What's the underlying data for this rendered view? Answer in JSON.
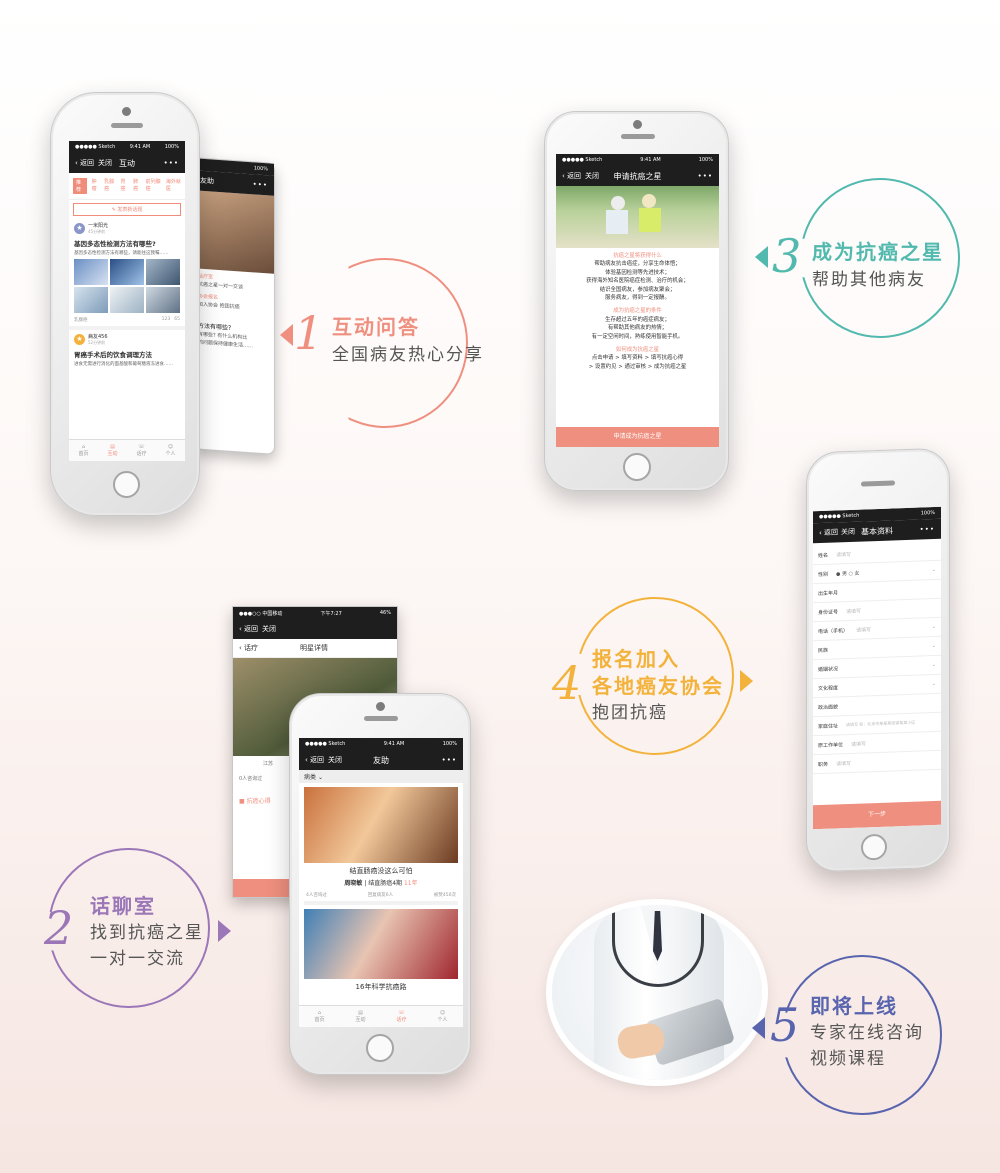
{
  "colors": {
    "coral": "#ef8f7f",
    "teal": "#51b9ad",
    "orange": "#f3b23b",
    "purple": "#9b77b8",
    "blue": "#5864ad"
  },
  "labels": {
    "l1": {
      "num": "1",
      "t1": "互动问答",
      "t2": "全国病友热心分享"
    },
    "l2": {
      "num": "2",
      "t1": "话聊室",
      "t2": "找到抗癌之星",
      "t3": "一对一交流"
    },
    "l3": {
      "num": "3",
      "t1": "成为抗癌之星",
      "t2": "帮助其他病友"
    },
    "l4": {
      "num": "4",
      "t1": "报名加入",
      "t2": "各地癌友协会",
      "t3": "抱团抗癌"
    },
    "l5": {
      "num": "5",
      "t1": "即将上线",
      "t2": "专家在线咨询",
      "t3": "视频课程"
    }
  },
  "p1": {
    "status": {
      "carrier": "●●●●● Sketch",
      "time": "9:41 AM",
      "battery": "100%"
    },
    "nav": {
      "back": "返回",
      "close": "关闭",
      "title": "互动",
      "more": "•••"
    },
    "tabs": [
      "推荐",
      "肿瘤",
      "乳腺癌",
      "胃癌",
      "肺癌",
      "前列腺癌",
      "海外就医"
    ],
    "post_button": "发表新话题",
    "post1": {
      "user": "一米阳光",
      "meta": "45分钟前",
      "title": "基因多态性检测方法有哪些?",
      "body": "基因多态性检测方法有哪些，请能往这我嘱……",
      "tag": "乳腺癌",
      "likes": "123",
      "comments": "65"
    },
    "post2": {
      "user": "病友456",
      "meta": "52分钟前",
      "title": "胃癌手术后的饮食调理方法",
      "body": "进食无需进行消化的面基酸和葡萄糖液冻进食……"
    },
    "tabbar": [
      "首页",
      "互动",
      "话疗",
      "个人"
    ]
  },
  "p1b": {
    "nav": {
      "title": "友助",
      "more": "•••"
    },
    "lines": [
      "话疗室",
      "抗癌之星一对一交谈",
      "协会报名",
      "加入协会 抱团抗癌",
      "方法有哪些?",
      "有哪些? 有什么机构比",
      "的问题保持健康生活……"
    ],
    "likes": "65",
    "comments": "65"
  },
  "p2back": {
    "status": {
      "carrier": "●●●○○ 中国移动",
      "time": "下午7:27",
      "battery": "46%"
    },
    "nav": {
      "back": "返回",
      "close": "关闭"
    },
    "sub": {
      "back": "话疗",
      "title": "明星详情"
    },
    "bits": [
      "江苏",
      "抗",
      "0人咨询过",
      "抗癌心得"
    ]
  },
  "p2": {
    "status": {
      "carrier": "●●●●● Sketch",
      "time": "9:41 AM",
      "battery": "100%"
    },
    "nav": {
      "back": "返回",
      "close": "关闭",
      "title": "友助",
      "more": "•••"
    },
    "filter": "病类",
    "card1": {
      "headline": "结直肠癌没这么可怕",
      "name": "周晓敏",
      "desc": "结直肠癌4期",
      "years": "11年",
      "s1": "4人咨询过",
      "s2": "回复病友6人",
      "s3": "被赞450次"
    },
    "card2": {
      "headline": "16年科学抗癌路",
      "name": "王丽萍"
    },
    "tabbar": [
      "首页",
      "互动",
      "话疗",
      "个人"
    ]
  },
  "p3": {
    "status": {
      "carrier": "●●●●● Sketch",
      "time": "9:41 AM",
      "battery": "100%"
    },
    "nav": {
      "back": "返回",
      "close": "关闭",
      "title": "申请抗癌之星",
      "more": "•••"
    },
    "h1": "抗癌之星将获得什么",
    "s1": [
      "帮助病友抗击癌症，分享生命体悟；",
      "体验基因检测等先进技术；",
      "获得海外知名医院癌症检测、治疗的机会；",
      "结识全国病友，参加病友聚会；",
      "服务病友，得到一定报酬。"
    ],
    "h2": "成为抗癌之星的条件",
    "s2": [
      "生存超过五年的癌症病友；",
      "有帮助其他病友的热情；",
      "有一定空闲时间，熟练使用智能手机。"
    ],
    "h3": "如何成为抗癌之星",
    "s3": [
      "点击申请 > 填写资料 > 填写抗癌心得",
      "> 设置约见 > 通过审核 > 成为抗癌之星"
    ],
    "button": "申请成为抗癌之星"
  },
  "p4": {
    "status": {
      "carrier": "●●●●● Sketch",
      "time": "9:41 AM",
      "battery": "100%"
    },
    "nav": {
      "back": "返回",
      "close": "关闭",
      "title": "基本资料",
      "more": "•••"
    },
    "rows": [
      {
        "k": "姓名",
        "v": "请填写"
      },
      {
        "k": "性别",
        "v": "● 男   ○ 女"
      },
      {
        "k": "出生年月",
        "v": ""
      },
      {
        "k": "身份证号",
        "v": "请填写"
      },
      {
        "k": "电话（手机）",
        "v": "请填写"
      },
      {
        "k": "民族",
        "v": ""
      },
      {
        "k": "婚姻状况",
        "v": ""
      },
      {
        "k": "文化程度",
        "v": ""
      },
      {
        "k": "政治面貌",
        "v": ""
      },
      {
        "k": "家庭住址",
        "v": "请填写 如：北京市某某某街道某某小区"
      },
      {
        "k": "原工作单位",
        "v": "请填写"
      },
      {
        "k": "职务",
        "v": "请填写"
      }
    ],
    "button": "下一步"
  }
}
